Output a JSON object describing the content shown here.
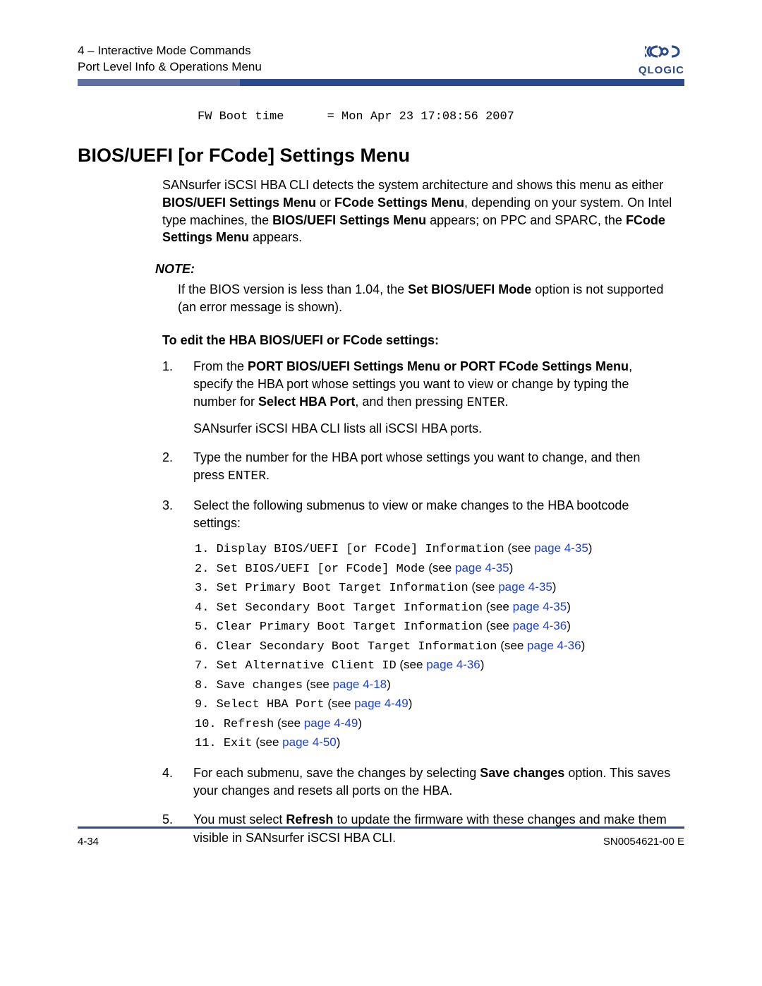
{
  "header": {
    "line1": "4 – Interactive Mode Commands",
    "line2": "Port Level Info & Operations Menu",
    "logo_glyph": "ꭥ",
    "logo_text": "QLOGIC"
  },
  "code_line": "FW Boot time      = Mon Apr 23 17:08:56 2007",
  "h1": "BIOS/UEFI [or FCode] Settings Menu",
  "intro": {
    "pre1": "SANsurfer iSCSI HBA CLI detects the system architecture and shows this menu as either ",
    "b1": "BIOS/UEFI Settings Menu",
    "mid1": " or ",
    "b2": "FCode Settings Menu",
    "mid2": ", depending on your system. On Intel type machines, the ",
    "b3": "BIOS/UEFI Settings Menu",
    "mid3": " appears; on PPC and SPARC, the ",
    "b4": "FCode Settings Menu",
    "post": " appears."
  },
  "note_label": "NOTE:",
  "note": {
    "pre": "If the BIOS version is less than 1.04, the ",
    "b": "Set BIOS/UEFI Mode",
    "post": " option is not supported (an error message is shown)."
  },
  "subhead": "To edit the HBA BIOS/UEFI or FCode settings:",
  "steps": {
    "s1": {
      "num": "1.",
      "pre": "From the ",
      "b1": "PORT BIOS/UEFI Settings Menu or PORT FCode Settings Menu",
      "mid1": ", specify the HBA port whose settings you want to view or change by typing the number for ",
      "b2": "Select HBA Port",
      "mid2": ", and then pressing ",
      "enter": "ENTER",
      "dot": ".",
      "p2": "SANsurfer iSCSI HBA CLI lists all iSCSI HBA ports."
    },
    "s2": {
      "num": "2.",
      "pre": "Type the number for the HBA port whose settings you want to change, and then press ",
      "enter": "ENTER",
      "dot": "."
    },
    "s3": {
      "num": "3.",
      "body": "Select the following submenus to view or make changes to the HBA bootcode settings:"
    },
    "s4": {
      "num": "4.",
      "pre": "For each submenu, save the changes by selecting ",
      "b": "Save changes",
      "post": " option. This saves your changes and resets all ports on the HBA."
    },
    "s5": {
      "num": "5.",
      "pre": "You must select ",
      "b": "Refresh",
      "post": " to update the firmware with these changes and make them visible in SANsurfer iSCSI HBA CLI."
    }
  },
  "sub_items": [
    {
      "num": " 1.",
      "cmd": "Display BIOS/UEFI [or FCode] Information",
      "see": " (see ",
      "link": "page 4-35",
      "close": ")"
    },
    {
      "num": " 2.",
      "cmd": "Set BIOS/UEFI [or FCode] Mode",
      "see": " (see ",
      "link": "page 4-35",
      "close": ")"
    },
    {
      "num": " 3.",
      "cmd": "Set Primary Boot Target Information",
      "see": " (see ",
      "link": "page 4-35",
      "close": ")"
    },
    {
      "num": " 4.",
      "cmd": "Set Secondary Boot Target Information",
      "see": " (see ",
      "link": "page 4-35",
      "close": ")"
    },
    {
      "num": " 5.",
      "cmd": "Clear Primary Boot Target Information",
      "see": " (see ",
      "link": "page 4-36",
      "close": ")"
    },
    {
      "num": " 6.",
      "cmd": "Clear Secondary Boot Target Information",
      "see": " (see ",
      "link": "page 4-36",
      "close": ")"
    },
    {
      "num": " 7.",
      "cmd": "Set Alternative Client ID",
      "see": " (see ",
      "link": "page 4-36",
      "close": ")"
    },
    {
      "num": " 8.",
      "cmd": "Save changes",
      "see": " (see ",
      "link": "page 4-18",
      "close": ")"
    },
    {
      "num": " 9.",
      "cmd": "Select HBA Port",
      "see": " (see ",
      "link": "page 4-49",
      "close": ")"
    },
    {
      "num": "10.",
      "cmd": "Refresh",
      "see": " (see ",
      "link": "page 4-49",
      "close": ")"
    },
    {
      "num": "11.",
      "cmd": "Exit",
      "see": " (see ",
      "link": "page 4-50",
      "close": ")"
    }
  ],
  "footer": {
    "page": "4-34",
    "doc": "SN0054621-00  E"
  }
}
